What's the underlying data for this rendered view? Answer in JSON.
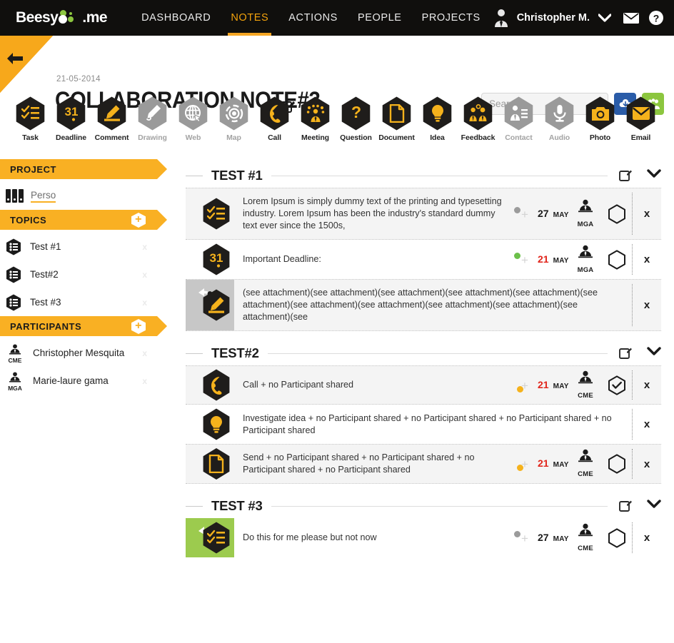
{
  "brand": {
    "name_1": "Beesy",
    "name_2": ".me",
    "accent": "#8cc63f"
  },
  "topnav": {
    "items": [
      {
        "label": "DASHBOARD",
        "active": false
      },
      {
        "label": "NOTES",
        "active": true
      },
      {
        "label": "ACTIONS",
        "active": false
      },
      {
        "label": "PEOPLE",
        "active": false
      },
      {
        "label": "PROJECTS",
        "active": false
      }
    ],
    "user": "Christopher M.",
    "mail_icon": "envelope-icon",
    "help_icon": "help-icon",
    "accent": "#f5a623"
  },
  "titlebar": {
    "back_icon": "back-arrow-icon",
    "date": "21-05-2014",
    "title": "COLLABORATION NOTE#3",
    "edit_icon": "edit-icon"
  },
  "search": {
    "placeholder": "Search...",
    "value": "",
    "upload_icon": "upload-icon",
    "share_icon": "people-group-icon",
    "upload_color": "#2a5ca8",
    "share_color": "#8cc63f"
  },
  "toolbar": {
    "tools": [
      {
        "label": "Task",
        "icon": "task-icon",
        "disabled": false
      },
      {
        "label": "Deadline",
        "icon": "deadline-icon",
        "disabled": false
      },
      {
        "label": "Comment",
        "icon": "comment-icon",
        "disabled": false
      },
      {
        "label": "Drawing",
        "icon": "drawing-icon",
        "disabled": true
      },
      {
        "label": "Web",
        "icon": "web-icon",
        "disabled": true
      },
      {
        "label": "Map",
        "icon": "map-icon",
        "disabled": true
      },
      {
        "label": "Call",
        "icon": "call-icon",
        "disabled": false
      },
      {
        "label": "Meeting",
        "icon": "meeting-icon",
        "disabled": false
      },
      {
        "label": "Question",
        "icon": "question-icon",
        "disabled": false
      },
      {
        "label": "Document",
        "icon": "document-icon",
        "disabled": false
      },
      {
        "label": "Idea",
        "icon": "idea-icon",
        "disabled": false
      },
      {
        "label": "Feedback",
        "icon": "feedback-icon",
        "disabled": false
      },
      {
        "label": "Contact",
        "icon": "contact-icon",
        "disabled": true
      },
      {
        "label": "Audio",
        "icon": "audio-icon",
        "disabled": true
      },
      {
        "label": "Photo",
        "icon": "photo-icon",
        "disabled": false
      },
      {
        "label": "Email",
        "icon": "email-icon",
        "disabled": false
      }
    ]
  },
  "sidebar": {
    "project_band": "PROJECT",
    "project": {
      "label": "Perso",
      "icon": "binders-icon"
    },
    "topics_band": "TOPICS",
    "topics": [
      {
        "label": "Test #1",
        "icon": "topic-icon",
        "delete": "x"
      },
      {
        "label": "Test#2",
        "icon": "topic-icon",
        "delete": "x"
      },
      {
        "label": "Test #3",
        "icon": "topic-icon",
        "delete": "x"
      }
    ],
    "participants_band": "PARTICIPANTS",
    "participants": [
      {
        "label": "Christopher Mesquita",
        "initials": "CME",
        "icon": "person-icon",
        "delete": "x"
      },
      {
        "label": "Marie-laure gama",
        "initials": "MGA",
        "icon": "person-icon",
        "delete": "x"
      }
    ],
    "add_icon": "plus-hex-icon"
  },
  "sections": [
    {
      "title": "TEST #1",
      "edit_icon": "edit-icon",
      "chevron_icon": "chevron-down-icon",
      "rows": [
        {
          "type_icon": "task-icon",
          "text": "Lorem Ipsum is simply dummy text of the printing and typesetting industry. Lorem Ipsum has been the industry's standard dummy text ever since the 1500s,",
          "shaded": true,
          "tag": "none",
          "status_dot": "#9b9b9b",
          "status_dot_pos": "tl",
          "day": "27",
          "month": "MAY",
          "day_color": "#1b1b1b",
          "owner": "MGA",
          "owner_icon": "person-icon",
          "state_icon": "hexagon-empty-icon",
          "close": "x"
        },
        {
          "type_icon": "deadline-icon",
          "text": "Important Deadline:",
          "shaded": false,
          "tag": "none",
          "status_dot": "#6cc04a",
          "status_dot_pos": "tl",
          "day": "21",
          "month": "MAY",
          "day_color": "#e1251b",
          "owner": "MGA",
          "owner_icon": "person-icon",
          "state_icon": "hexagon-empty-icon",
          "close": "x"
        },
        {
          "type_icon": "comment-icon",
          "text": "(see attachment)(see attachment)(see attachment)(see attachment)(see attachment)(see attachment)(see attachment)(see attachment)(see attachment)(see attachment)(see attachment)(see",
          "shaded": true,
          "tag": "grey",
          "tag_icon": "reply-person-icon",
          "status_dot": "",
          "day": "",
          "month": "",
          "day_color": "",
          "owner": "",
          "owner_icon": "",
          "state_icon": "",
          "close": "x"
        }
      ]
    },
    {
      "title": "TEST#2",
      "edit_icon": "edit-icon",
      "chevron_icon": "chevron-down-icon",
      "rows": [
        {
          "type_icon": "call-icon",
          "text": "Call + no Participant shared",
          "shaded": true,
          "tag": "none",
          "status_dot": "#f5b21c",
          "status_dot_pos": "bl",
          "day": "21",
          "month": "MAY",
          "day_color": "#e1251b",
          "owner": "CME",
          "owner_icon": "person-icon",
          "state_icon": "hexagon-check-icon",
          "close": "x"
        },
        {
          "type_icon": "idea-icon",
          "text": "Investigate idea + no Participant shared + no Participant shared + no Participant shared + no Participant shared",
          "shaded": false,
          "tag": "none",
          "status_dot": "",
          "day": "",
          "month": "",
          "day_color": "",
          "owner": "",
          "owner_icon": "",
          "state_icon": "",
          "close": "x"
        },
        {
          "type_icon": "document-icon",
          "text": "Send + no Participant shared + no Participant shared + no Participant shared + no Participant shared",
          "shaded": true,
          "tag": "none",
          "status_dot": "#f5b21c",
          "status_dot_pos": "bl",
          "day": "21",
          "month": "MAY",
          "day_color": "#e1251b",
          "owner": "CME",
          "owner_icon": "person-icon",
          "state_icon": "hexagon-empty-icon",
          "close": "x"
        }
      ]
    },
    {
      "title": "TEST #3",
      "edit_icon": "edit-icon",
      "chevron_icon": "chevron-down-icon",
      "rows": [
        {
          "type_icon": "task-icon",
          "text": "Do this for me please but not now",
          "shaded": false,
          "tag": "green",
          "tag_icon": "reply-person-icon",
          "status_dot": "#9b9b9b",
          "status_dot_pos": "tl",
          "day": "27",
          "month": "MAY",
          "day_color": "#1b1b1b",
          "owner": "CME",
          "owner_icon": "person-icon",
          "state_icon": "hexagon-empty-icon",
          "close": "x"
        }
      ]
    }
  ]
}
